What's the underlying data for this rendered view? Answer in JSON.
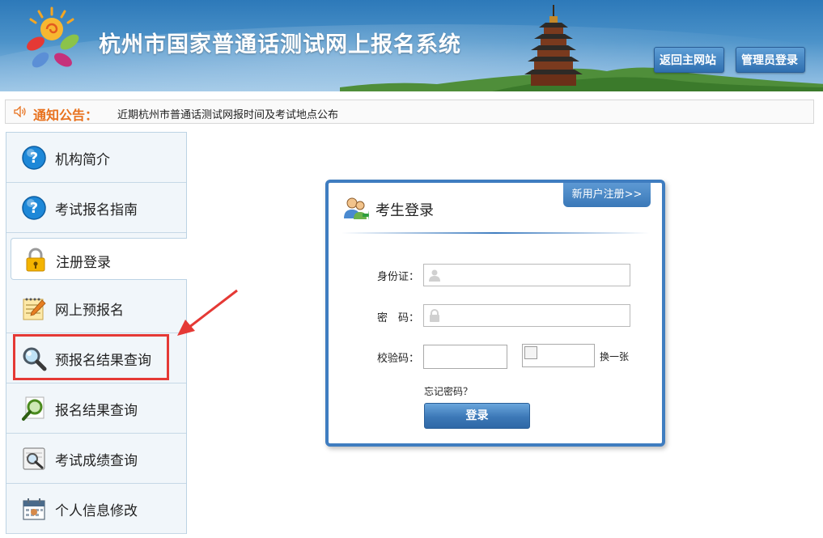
{
  "header": {
    "title": "杭州市国家普通话测试网上报名系统",
    "home_button": "返回主网站",
    "admin_button": "管理员登录"
  },
  "notice": {
    "label": "通知公告：",
    "text": "近期杭州市普通话测试网报时间及考试地点公布"
  },
  "sidebar": {
    "items": [
      {
        "label": "机构简介",
        "icon": "question-icon"
      },
      {
        "label": "考试报名指南",
        "icon": "question-icon"
      },
      {
        "label": "注册登录",
        "icon": "lock-icon"
      },
      {
        "label": "网上预报名",
        "icon": "notepad-icon"
      },
      {
        "label": "预报名结果查询",
        "icon": "magnifier-icon"
      },
      {
        "label": "报名结果查询",
        "icon": "magnifier-green-icon"
      },
      {
        "label": "考试成绩查询",
        "icon": "document-search-icon"
      },
      {
        "label": "个人信息修改",
        "icon": "calendar-icon"
      }
    ],
    "active_index": 2,
    "highlighted_index": 4
  },
  "login": {
    "title": "考生登录",
    "register_link": "新用户注册>>",
    "id_label": "身份证：",
    "password_label": "密　码：",
    "captcha_label": "校验码：",
    "refresh_captcha": "换一张",
    "forgot_password": "忘记密码？",
    "submit": "登录"
  },
  "colors": {
    "header_blue": "#2d79b9",
    "notice_orange": "#e8721f",
    "login_border": "#3f7dc0",
    "highlight_red": "#e53935"
  }
}
